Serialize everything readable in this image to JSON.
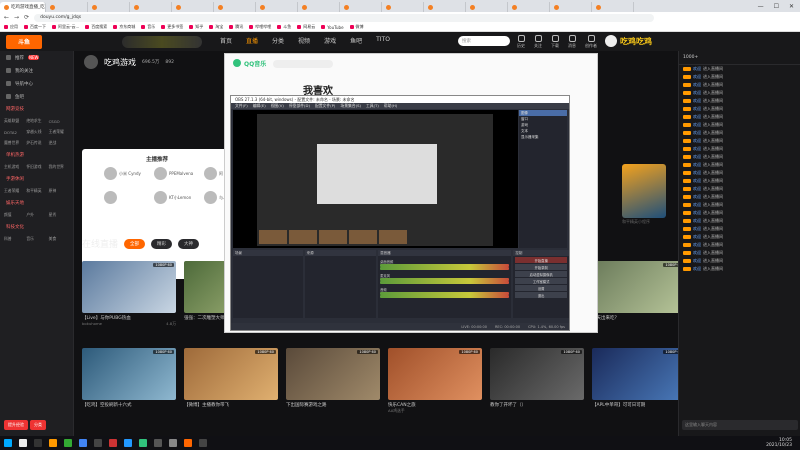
{
  "browser": {
    "tabs": [
      "吃鸡游戏直播_吃鸡游戏视频直播 - ...",
      "",
      "",
      "",
      "",
      "",
      "",
      "",
      "",
      "",
      "",
      "",
      "",
      "",
      ""
    ],
    "url": "douyu.com/g_jdqs",
    "bookmarks": [
      "应用",
      "百度一下",
      "阿里云-云...",
      "百度搜索",
      "京东商城",
      "音乐",
      "更多书签",
      "知乎",
      "淘宝",
      "腾讯",
      "哔哩哔哩",
      "斗鱼",
      "网易云",
      "YouTube",
      "微博"
    ]
  },
  "site": {
    "logo": "斗鱼",
    "nav": [
      "首页",
      "直播",
      "分类",
      "视频",
      "游戏",
      "鱼吧",
      "TITO"
    ],
    "search_placeholder": "搜索",
    "header_icons": [
      "历史",
      "关注",
      "下载",
      "消息",
      "创作者"
    ],
    "brand": "吃鸡吃鸡"
  },
  "sidebar": {
    "top_items": [
      {
        "label": "推荐",
        "badge": "NEW"
      },
      {
        "label": "我的关注"
      },
      {
        "label": "导航中心"
      },
      {
        "label": "鱼吧"
      }
    ],
    "sections": [
      {
        "title": "网游竞技",
        "items": [
          "英雄联盟",
          "绝地求生",
          "CSGO",
          "DOTA2",
          "穿越火线",
          "王者荣耀",
          "魔兽世界",
          "炉石传说",
          "逆战"
        ]
      },
      {
        "title": "单机热游",
        "items": [
          "主机游戏",
          "怀旧游戏",
          "我的世界"
        ]
      },
      {
        "title": "手游休闲",
        "items": [
          "王者荣耀",
          "和平精英",
          "原神"
        ]
      },
      {
        "title": "娱乐天地",
        "items": [
          "颜值",
          "户外",
          "星秀"
        ]
      },
      {
        "title": "科技文化",
        "items": [
          "科普",
          "音乐",
          "美食"
        ]
      }
    ],
    "bottom_buttons": [
      "提升经验",
      "分类"
    ]
  },
  "channel": {
    "name": "吃鸡游戏",
    "viewers": "696.5万",
    "fans": "892"
  },
  "streamers": {
    "title": "主播推荐",
    "items": [
      "小米 Cyndy",
      "PPEMalvena",
      "阿",
      "",
      "KT小Lemon",
      "与人流"
    ]
  },
  "live": {
    "title": "在线直播",
    "filters": [
      "全部",
      "精彩",
      "大神"
    ]
  },
  "cards": [
    {
      "title": "【Live】与你PUBG热血",
      "author": "bokuhome",
      "viewers": "4.8万",
      "quality": "1080P 60"
    },
    {
      "title": "强强：二次雕塑大师",
      "author": "",
      "viewers": "3.5万",
      "quality": "1080P"
    },
    {
      "title": "",
      "author": "",
      "viewers": "",
      "quality": ""
    },
    {
      "title": "",
      "author": "",
      "viewers": "",
      "quality": ""
    },
    {
      "title": "",
      "author": "",
      "viewers": "",
      "quality": ""
    },
    {
      "title": "今天出来吃？",
      "author": "",
      "viewers": "",
      "quality": "1080P 60"
    },
    {
      "title": "【吃鸡】空投刷新十六式",
      "author": "",
      "viewers": "",
      "quality": "1080P 60"
    },
    {
      "title": "【微博】主播教你带飞",
      "author": "",
      "viewers": "",
      "quality": "1080P 60"
    },
    {
      "title": "下出国际赛游戏之路",
      "author": "",
      "viewers": "",
      "quality": "1080P 60"
    },
    {
      "title": "快乐CAN之旅",
      "author": "AA鸡选手",
      "viewers": "",
      "quality": "1080P 60"
    },
    {
      "title": "教你了开坏了（）",
      "author": "",
      "viewers": "",
      "quality": "1080P 60"
    },
    {
      "title": "【APL中单哥】可可日可期",
      "author": "",
      "viewers": "",
      "quality": "1080P 60"
    }
  ],
  "pubg": {
    "label": "和平精英小程序"
  },
  "qq": {
    "app": "QQ音乐",
    "heading": "我喜欢"
  },
  "obs": {
    "title": "OBS 27.1.3 (64-bit, windows) - 配置文件: 未命名 - 场景: 未命名",
    "menu": [
      "文件(F)",
      "编辑(E)",
      "视图(V)",
      "停靠部件(D)",
      "配置文件(P)",
      "场景集合(S)",
      "工具(T)",
      "帮助(H)"
    ],
    "sources": [
      "图像",
      "窗口",
      "游戏",
      "文本",
      "显示器采集"
    ],
    "panels": [
      "场景",
      "来源",
      "混音器",
      "转场动画",
      "控制"
    ],
    "mixer": [
      "桌面音频",
      "麦克风",
      "音频"
    ],
    "controls": [
      "开始直播",
      "开始录制",
      "启动虚拟摄像机",
      "工作室模式",
      "设置",
      "退出"
    ],
    "status": [
      "LIVE: 00:00:00",
      "REC: 00:00:00",
      "CPU: 1.4%, 60.00 fps"
    ]
  },
  "chat": {
    "header": "1000+",
    "lines": [
      {
        "name": "欢迎",
        "text": "进入直播间"
      },
      {
        "name": "欢迎",
        "text": "进入直播间"
      },
      {
        "name": "欢迎",
        "text": "进入直播间"
      },
      {
        "name": "欢迎",
        "text": "进入直播间"
      },
      {
        "name": "欢迎",
        "text": "进入直播间"
      },
      {
        "name": "欢迎",
        "text": "进入直播间"
      },
      {
        "name": "欢迎",
        "text": "进入直播间"
      },
      {
        "name": "欢迎",
        "text": "进入直播间"
      },
      {
        "name": "欢迎",
        "text": "进入直播间"
      },
      {
        "name": "欢迎",
        "text": "进入直播间"
      },
      {
        "name": "欢迎",
        "text": "进入直播间"
      },
      {
        "name": "欢迎",
        "text": "进入直播间"
      },
      {
        "name": "欢迎",
        "text": "进入直播间"
      },
      {
        "name": "欢迎",
        "text": "进入直播间"
      },
      {
        "name": "欢迎",
        "text": "进入直播间"
      },
      {
        "name": "欢迎",
        "text": "进入直播间"
      },
      {
        "name": "欢迎",
        "text": "进入直播间"
      },
      {
        "name": "欢迎",
        "text": "进入直播间"
      },
      {
        "name": "欢迎",
        "text": "进入直播间"
      },
      {
        "name": "欢迎",
        "text": "进入直播间"
      },
      {
        "name": "欢迎",
        "text": "进入直播间"
      },
      {
        "name": "欢迎",
        "text": "进入直播间"
      },
      {
        "name": "欢迎",
        "text": "进入直播间"
      },
      {
        "name": "欢迎",
        "text": "进入直播间"
      },
      {
        "name": "欢迎",
        "text": "进入直播间"
      },
      {
        "name": "欢迎",
        "text": "进入直播间"
      }
    ],
    "input_placeholder": "这里输入聊天内容"
  },
  "taskbar": {
    "time": "10:05",
    "date": "2021/10/23"
  },
  "colors": {
    "accent": "#ff6600",
    "qq_green": "#31c27c",
    "obs_bg": "#2b2e38"
  }
}
